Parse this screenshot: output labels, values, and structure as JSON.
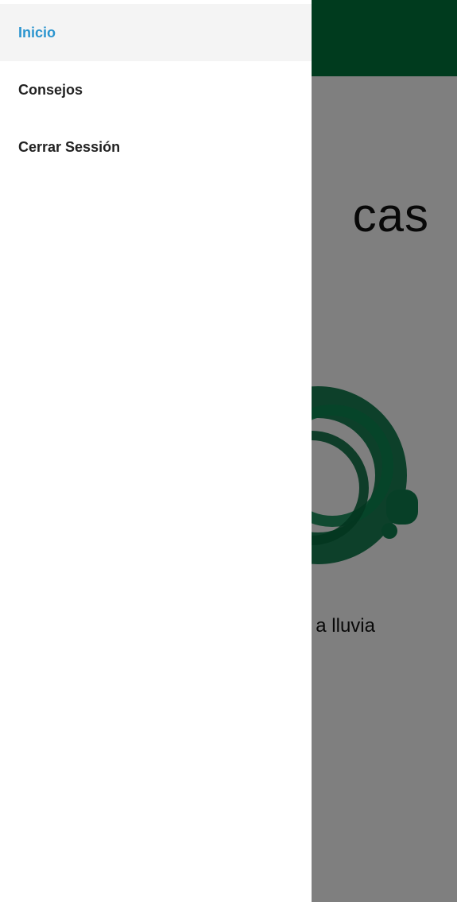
{
  "app": {
    "heading_fragment": "cas",
    "caption_fragment": "a lluvia",
    "brand_color": "#01773c"
  },
  "drawer": {
    "items": [
      {
        "label": "Inicio",
        "active": true
      },
      {
        "label": "Consejos",
        "active": false
      },
      {
        "label": "Cerrar Sessión",
        "active": false
      }
    ],
    "active_color": "#2b95cf"
  }
}
